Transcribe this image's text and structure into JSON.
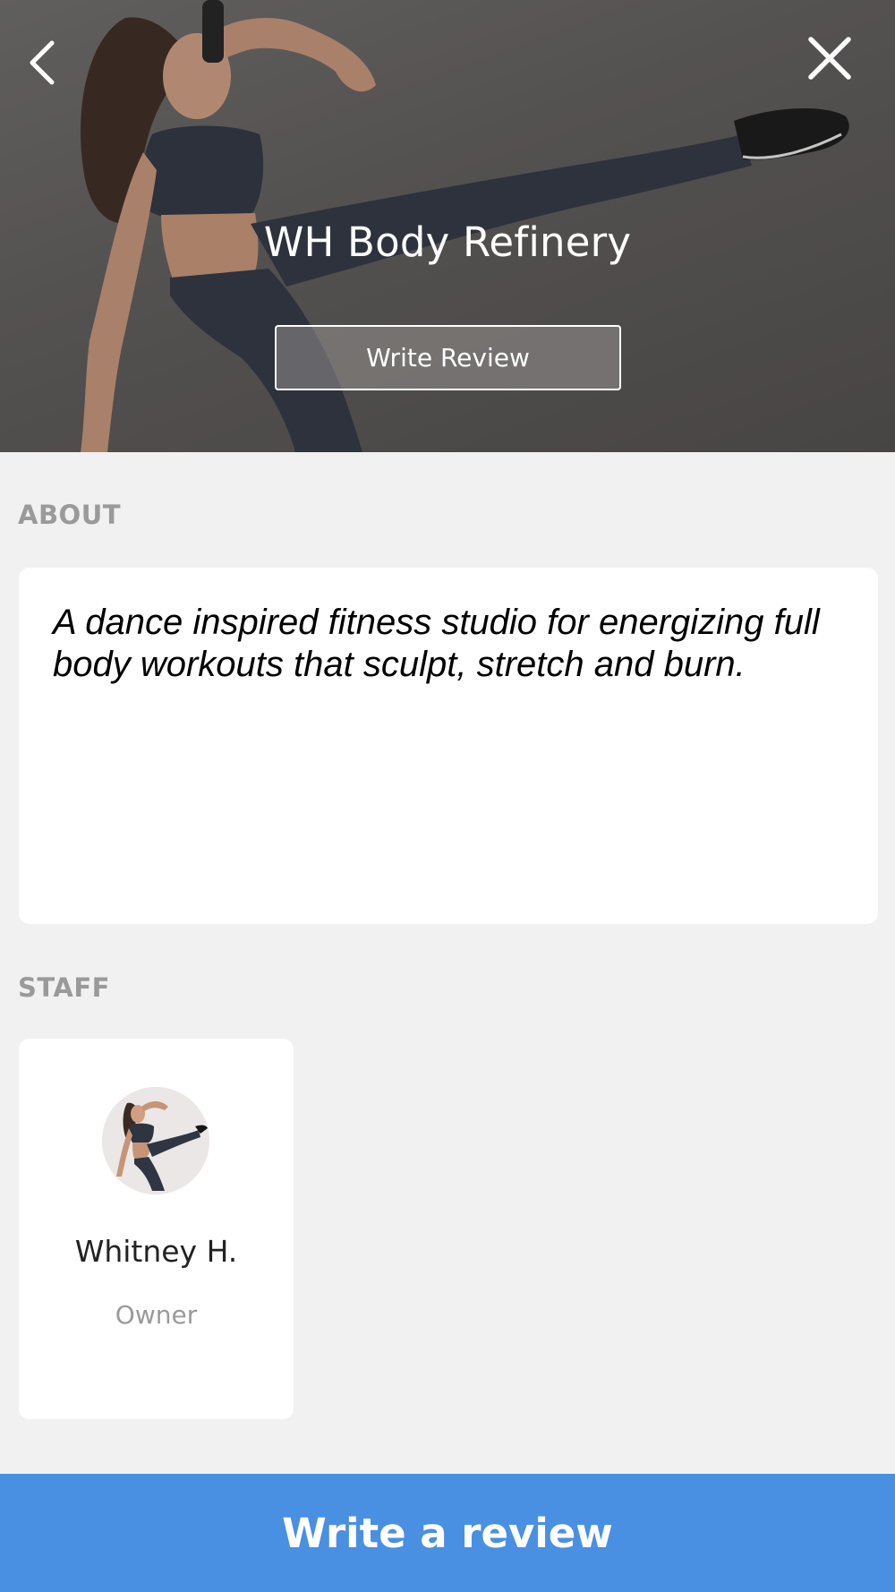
{
  "header": {
    "back_icon": "chevron-left-icon",
    "close_icon": "close-icon",
    "title": "WH Body Refinery",
    "write_review_label": "Write Review"
  },
  "about": {
    "label": "ABOUT",
    "text": "A dance inspired fitness studio for energizing full body workouts that sculpt, stretch and burn."
  },
  "staff": {
    "label": "STAFF",
    "members": [
      {
        "name": "Whitney H.",
        "role": "Owner"
      }
    ]
  },
  "footer": {
    "cta_label": "Write a review"
  },
  "colors": {
    "accent": "#4a90e2",
    "background": "#f2f1f1",
    "section_label": "#9a9a9a"
  }
}
